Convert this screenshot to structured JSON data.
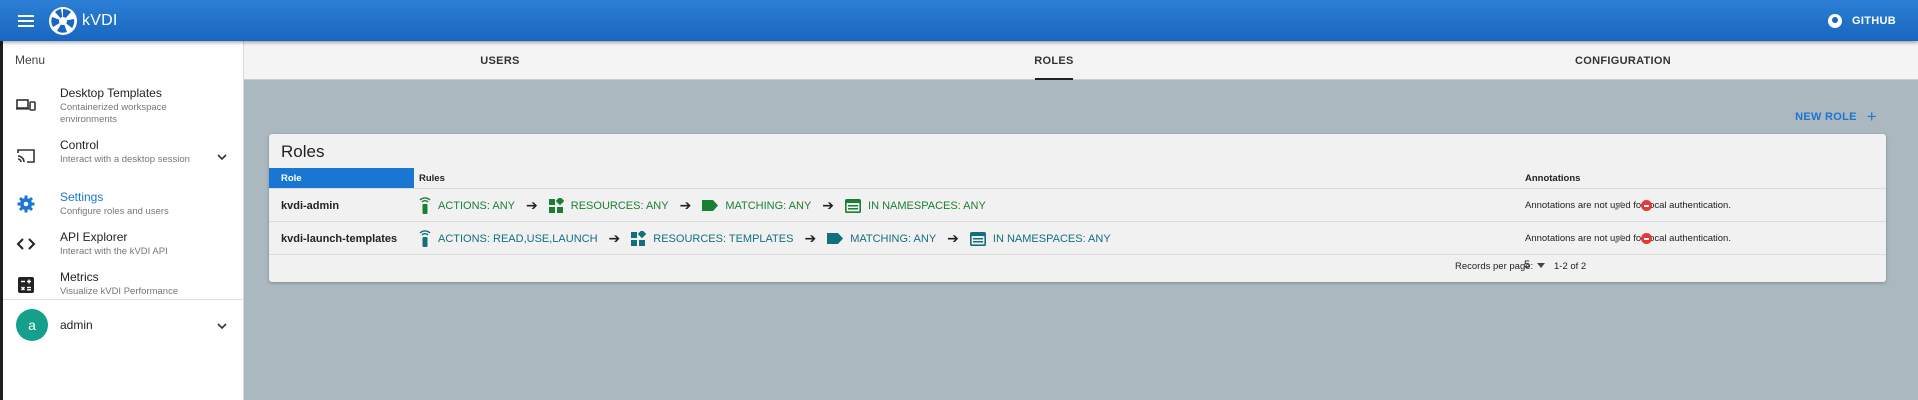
{
  "header": {
    "title": "kVDI",
    "github_label": "GITHUB"
  },
  "sidebar": {
    "menu_label": "Menu",
    "items": [
      {
        "title": "Desktop Templates",
        "subtitle": "Containerized workspace environments",
        "icon": "devices-icon"
      },
      {
        "title": "Control",
        "subtitle": "Interact with a desktop session",
        "icon": "cast-icon"
      },
      {
        "title": "Settings",
        "subtitle": "Configure roles and users",
        "icon": "gear-icon"
      },
      {
        "title": "API Explorer",
        "subtitle": "Interact with the kVDI API",
        "icon": "code-icon"
      },
      {
        "title": "Metrics",
        "subtitle": "Visualize kVDI Performance",
        "icon": "calculator-icon"
      }
    ],
    "user": {
      "avatar_letter": "a",
      "name": "admin"
    }
  },
  "tabs": [
    "USERS",
    "ROLES",
    "CONFIGURATION"
  ],
  "active_tab": "ROLES",
  "new_role_label": "NEW ROLE",
  "roles_card": {
    "title": "Roles",
    "columns": [
      "Role",
      "Rules",
      "Annotations"
    ],
    "rows": [
      {
        "role": "kvdi-admin",
        "rules": [
          "ACTIONS: ANY",
          "RESOURCES: ANY",
          "MATCHING: ANY",
          "IN NAMESPACES: ANY"
        ],
        "annotation": "Annotations are not used for local authentication."
      },
      {
        "role": "kvdi-launch-templates",
        "rules": [
          "ACTIONS: READ,USE,LAUNCH",
          "RESOURCES: TEMPLATES",
          "MATCHING: ANY",
          "IN NAMESPACES: ANY"
        ],
        "annotation": "Annotations are not used for local authentication."
      }
    ],
    "footer": {
      "records_label": "Records per page:",
      "records_value": "5",
      "pagination": "1-2 of 2"
    }
  },
  "colors": {
    "header": "#1866c0",
    "accent": "#1976d2",
    "rules_green": "#1b7f33",
    "rules_teal": "#146f7d",
    "delete": "#e53935",
    "avatar": "#15a08e"
  }
}
